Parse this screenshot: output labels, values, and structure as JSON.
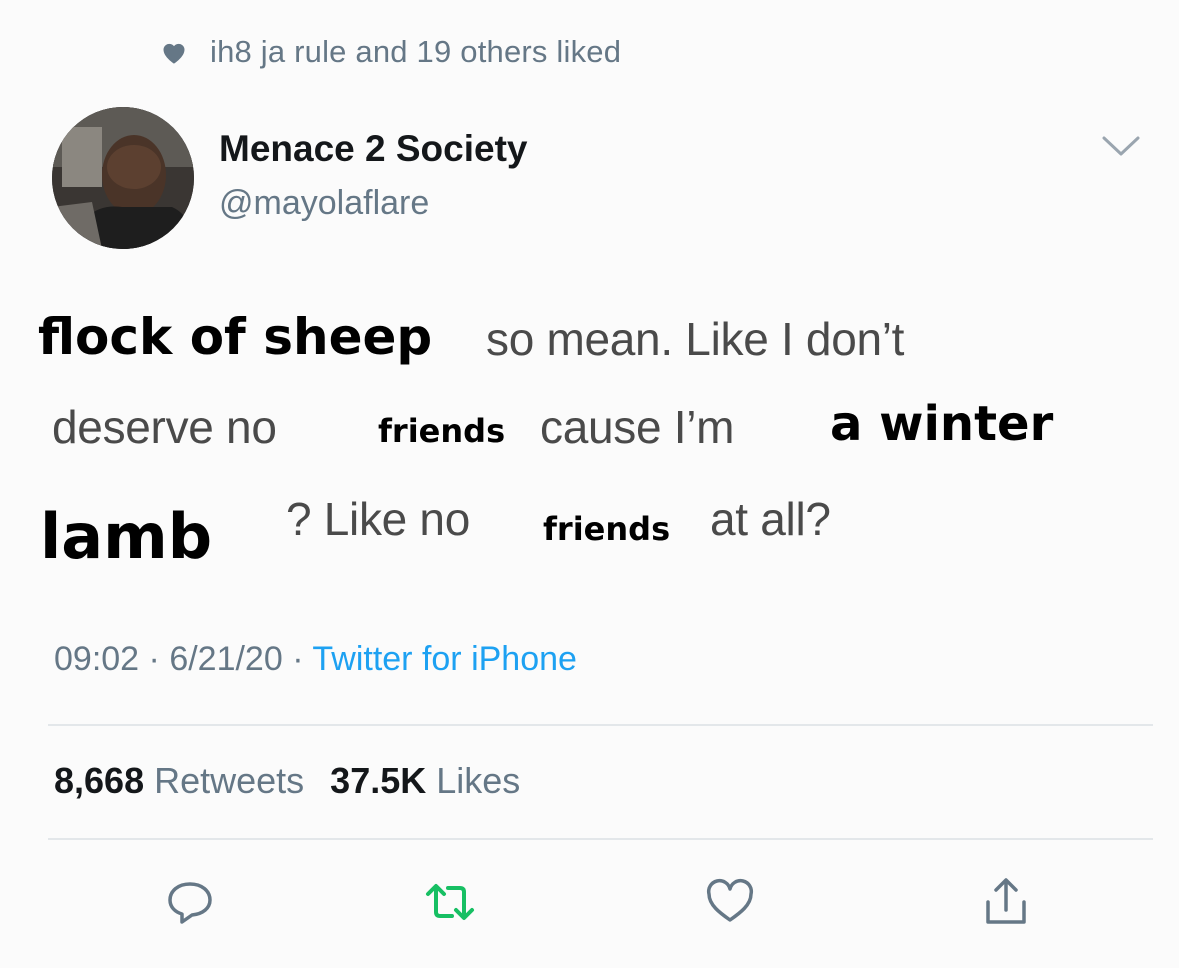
{
  "social_context": {
    "text": "ih8 ja rule and 19 others liked"
  },
  "author": {
    "display_name": "Menace 2 Society",
    "handle": "@mayolaflare"
  },
  "tweet": {
    "line1": {
      "w1": "flock of sheep",
      "w2": "so mean. Like I don’t"
    },
    "line2": {
      "w1": "deserve no",
      "w2": "friends",
      "w3": "cause I’m",
      "w4": "a winter"
    },
    "line3": {
      "w1": "lamb",
      "w2": "? Like no",
      "w3": "friends",
      "w4": "at all?"
    }
  },
  "meta": {
    "time": "09:02",
    "sep1": " · ",
    "date": "6/21/20",
    "sep2": " · ",
    "source": "Twitter for iPhone"
  },
  "stats": {
    "retweets_count": "8,668",
    "retweets_label": "Retweets",
    "likes_count": "37.5K",
    "likes_label": "Likes"
  },
  "actions": [
    "reply-icon",
    "retweet-icon",
    "like-icon",
    "share-icon"
  ],
  "colors": {
    "muted": "#657786",
    "link": "#1da1f2",
    "retweet_green": "#17bf63"
  }
}
